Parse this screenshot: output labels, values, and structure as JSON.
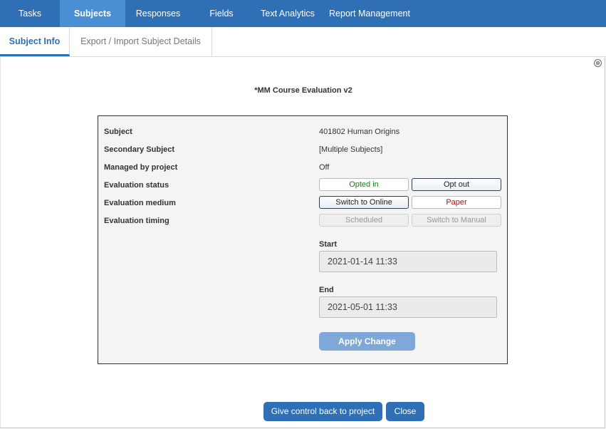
{
  "topnav": {
    "items": [
      {
        "label": "Tasks"
      },
      {
        "label": "Subjects"
      },
      {
        "label": "Responses"
      },
      {
        "label": "Fields"
      },
      {
        "label": "Text Analytics"
      },
      {
        "label": "Report Management"
      }
    ]
  },
  "subtabs": {
    "items": [
      {
        "label": "Subject Info"
      },
      {
        "label": "Export / Import Subject Details"
      }
    ]
  },
  "panel": {
    "close_glyph": "⊗",
    "title": "*MM Course Evaluation v2"
  },
  "details": {
    "subject": {
      "label": "Subject",
      "value": "401802 Human Origins"
    },
    "secondary_subject": {
      "label": "Secondary Subject",
      "value": "[Multiple Subjects]"
    },
    "managed_by_project": {
      "label": "Managed by project",
      "value": "Off"
    },
    "evaluation_status": {
      "label": "Evaluation status",
      "opt_in": "Opted in",
      "opt_out": "Opt out"
    },
    "evaluation_medium": {
      "label": "Evaluation medium",
      "switch_online": "Switch to Online",
      "paper": "Paper"
    },
    "evaluation_timing": {
      "label": "Evaluation timing",
      "scheduled": "Scheduled",
      "switch_manual": "Switch to Manual"
    },
    "start": {
      "label": "Start",
      "value": "2021-01-14 11:33"
    },
    "end": {
      "label": "End",
      "value": "2021-05-01 11:33"
    },
    "apply_label": "Apply Change"
  },
  "footer": {
    "give_control_label": "Give control back to project",
    "close_label": "Close"
  },
  "colors": {
    "nav_bg": "#2f6fb5",
    "nav_active": "#4a8ed4",
    "opted_in_text": "#1d7a1d",
    "paper_text": "#a31515",
    "apply_bg": "#7fa8d8"
  }
}
